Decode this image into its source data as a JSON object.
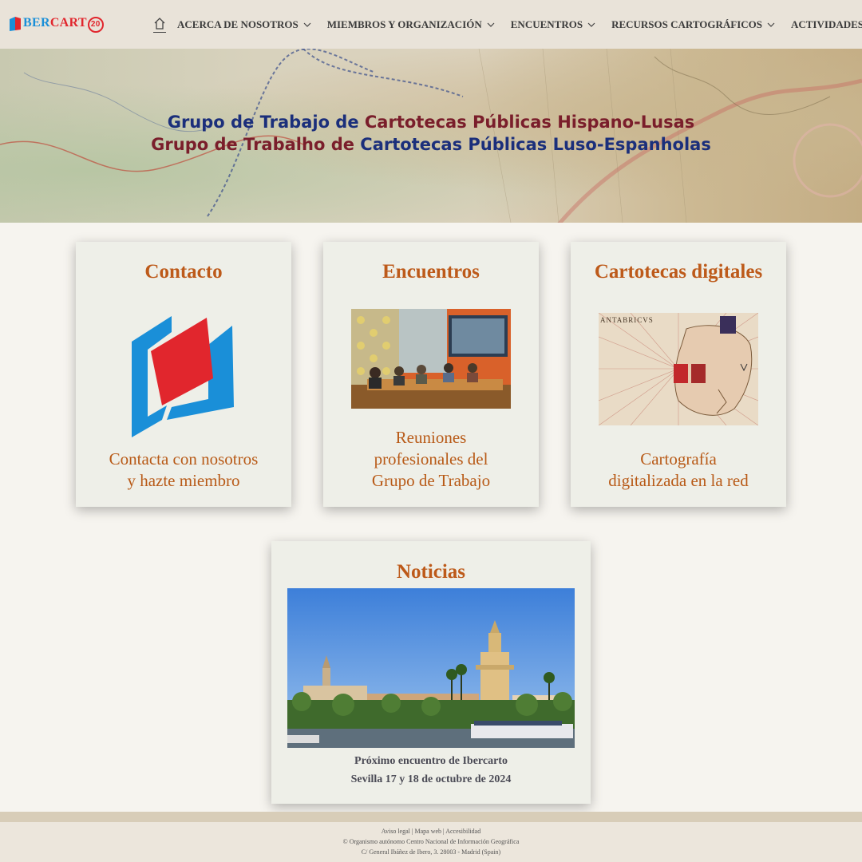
{
  "header": {
    "logo": {
      "prefix": "I",
      "ib": "BER",
      "cart": "CART",
      "badge": "20"
    },
    "nav": [
      {
        "label": "ACERCA DE NOSOTROS"
      },
      {
        "label": "MIEMBROS Y ORGANIZACIÓN"
      },
      {
        "label": "ENCUENTROS"
      },
      {
        "label": "RECURSOS CARTOGRÁFICOS"
      },
      {
        "label": "ACTIVIDADES"
      }
    ]
  },
  "hero": {
    "line1": {
      "a": "Grupo de Trabajo de ",
      "b": "Cartotecas Públicas Hispano-Lusas"
    },
    "line2": {
      "a": "Grupo de Trabalho de ",
      "b": "Cartotecas",
      "c": " Públicas Luso-Espanholas"
    }
  },
  "cards": [
    {
      "title": "Contacto",
      "text_line1": "Contacta con nosotros",
      "text_line2": "y hazte miembro"
    },
    {
      "title": "Encuentros",
      "text_line1": "Reuniones",
      "text_line2": "profesionales del",
      "text_line3": "Grupo de Trabajo"
    },
    {
      "title": "Cartotecas digitales",
      "text_line1": "Cartografía",
      "text_line2": "digitalizada en la red",
      "map_label": "ANTABRICVS"
    }
  ],
  "news": {
    "title": "Noticias",
    "line1": "Próximo encuentro de Ibercarto",
    "line2": "Sevilla 17 y 18 de octubre de 2024"
  },
  "footer": {
    "links": [
      "Aviso legal",
      "Mapa web",
      "Accesibilidad"
    ],
    "separator": " | ",
    "line2": "© Organismo autónomo Centro Nacional de Información Geográfica",
    "line3": "C/ General Ibáñez de Ibero, 3. 28003 - Madrid (Spain)"
  },
  "colors": {
    "accent": "#bd5a1a",
    "brand_blue": "#1a8fd8",
    "brand_red": "#e1262d",
    "hero_blue": "#1b2f7b",
    "hero_red": "#7a1e2b"
  }
}
